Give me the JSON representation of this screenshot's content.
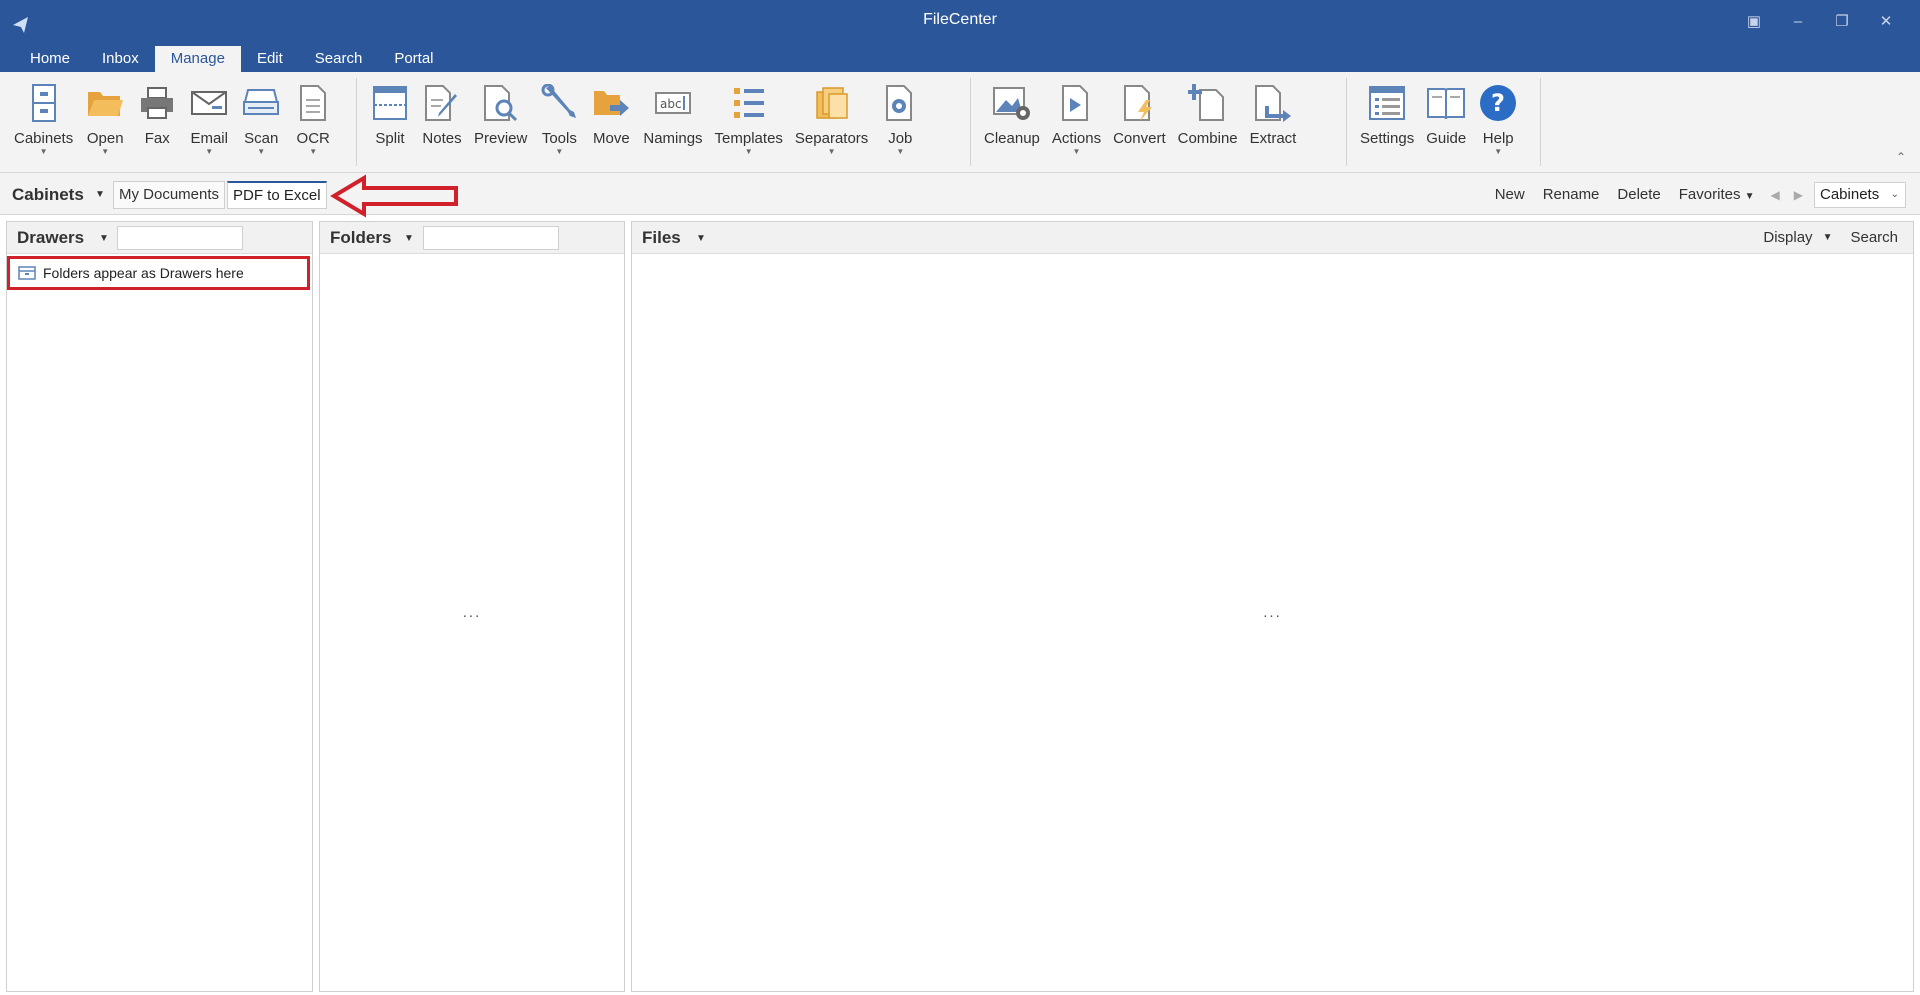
{
  "window": {
    "title": "FileCenter"
  },
  "menu": {
    "tabs": [
      "Home",
      "Inbox",
      "Manage",
      "Edit",
      "Search",
      "Portal"
    ]
  },
  "ribbon": {
    "buttons": [
      {
        "label": "Cabinets",
        "icon": "cabinet-icon"
      },
      {
        "label": "Open",
        "icon": "folder-open-icon"
      },
      {
        "label": "Fax",
        "icon": "printer-icon"
      },
      {
        "label": "Email",
        "icon": "email-icon"
      },
      {
        "label": "Scan",
        "icon": "scanner-icon"
      },
      {
        "label": "OCR",
        "icon": "ocr-document-icon"
      },
      {
        "label": "Split",
        "icon": "split-page-icon"
      },
      {
        "label": "Notes",
        "icon": "notes-pen-icon"
      },
      {
        "label": "Preview",
        "icon": "preview-magnifier-icon"
      },
      {
        "label": "Tools",
        "icon": "tools-wrench-icon"
      },
      {
        "label": "Move",
        "icon": "move-folder-icon"
      },
      {
        "label": "Namings",
        "icon": "naming-abc-icon"
      },
      {
        "label": "Templates",
        "icon": "templates-list-icon"
      },
      {
        "label": "Separators",
        "icon": "separators-stack-icon"
      },
      {
        "label": "Job",
        "icon": "job-gear-icon"
      },
      {
        "label": "Cleanup",
        "icon": "cleanup-image-icon"
      },
      {
        "label": "Actions",
        "icon": "actions-play-icon"
      },
      {
        "label": "Convert",
        "icon": "convert-lightning-icon"
      },
      {
        "label": "Combine",
        "icon": "combine-plus-icon"
      },
      {
        "label": "Extract",
        "icon": "extract-arrow-icon"
      },
      {
        "label": "Settings",
        "icon": "settings-list-icon"
      },
      {
        "label": "Guide",
        "icon": "guide-book-icon"
      },
      {
        "label": "Help",
        "icon": "help-question-icon"
      }
    ]
  },
  "cabinets_bar": {
    "title": "Cabinets",
    "tabs": [
      "My Documents",
      "PDF to Excel"
    ],
    "active_tab": "PDF to Excel",
    "actions": [
      "New",
      "Rename",
      "Delete",
      "Favorites"
    ],
    "dropdown_value": "Cabinets"
  },
  "panes": {
    "drawers": {
      "title": "Drawers",
      "item": "Folders appear as Drawers here"
    },
    "folders": {
      "title": "Folders",
      "empty": "..."
    },
    "files": {
      "title": "Files",
      "empty": "...",
      "display": "Display",
      "search": "Search"
    }
  },
  "colors": {
    "titlebar": "#2b579a",
    "ribbon_bg": "#f3f3f3",
    "annotation": "#d0202a"
  }
}
